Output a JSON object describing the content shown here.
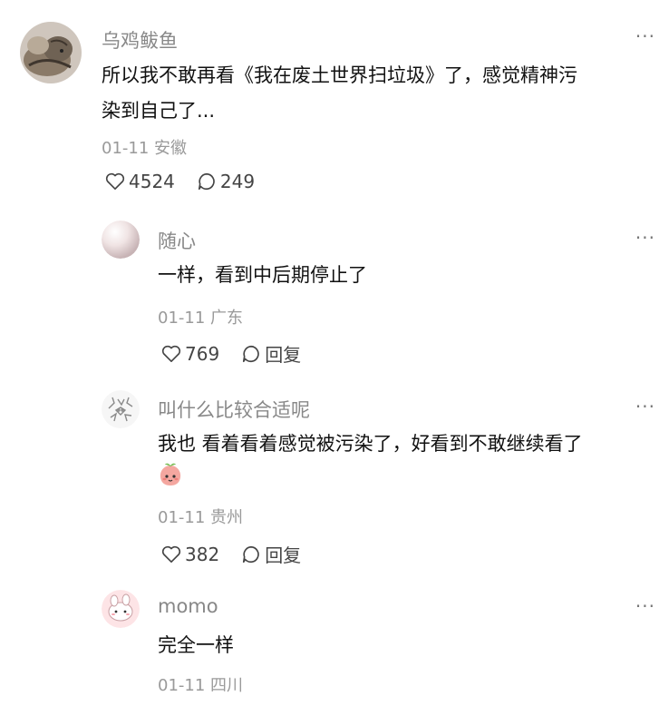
{
  "comments": [
    {
      "author": "乌鸡鲅鱼",
      "text_line1": "所以我不敢再看《我在废土世界扫垃圾》了，感觉精神污",
      "text_line2": "染到自己了...",
      "date": "01-11",
      "location": "安徽",
      "likes": "4524",
      "replies": "249",
      "more": "···"
    },
    {
      "author": "随心",
      "text": "一样，看到中后期停止了",
      "date": "01-11",
      "location": "广东",
      "likes": "769",
      "reply_label": "回复",
      "more": "···"
    },
    {
      "author": "叫什么比较合适呢",
      "text": "我也 看着看着感觉被污染了，好看到不敢继续看了",
      "emoji": "peach-face-emoji",
      "date": "01-11",
      "location": "贵州",
      "likes": "382",
      "reply_label": "回复",
      "more": "···"
    },
    {
      "author": "momo",
      "text": "完全一样",
      "date": "01-11",
      "location": "四川",
      "more": "···"
    }
  ]
}
